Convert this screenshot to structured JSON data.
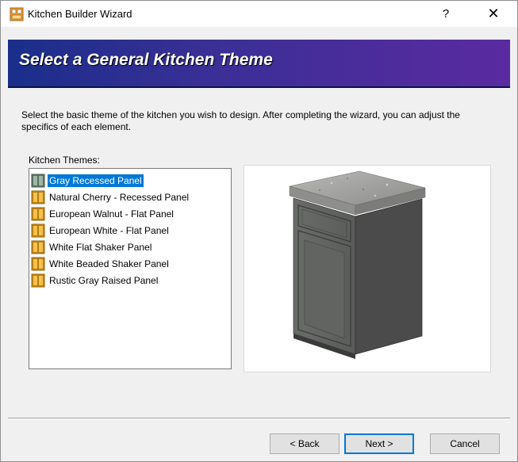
{
  "window": {
    "title": "Kitchen Builder Wizard",
    "help_label": "?",
    "close_label": "✕"
  },
  "banner": {
    "title": "Select a General Kitchen Theme"
  },
  "description": "Select the basic theme of the kitchen you wish to design. After completing the wizard, you can adjust the specifics of each element.",
  "themes": {
    "label": "Kitchen Themes:",
    "selected_index": 0,
    "items": [
      {
        "label": "Gray Recessed Panel",
        "icon": "cabinet-gray-icon"
      },
      {
        "label": "Natural Cherry - Recessed Panel",
        "icon": "cabinet-icon"
      },
      {
        "label": "European Walnut - Flat Panel",
        "icon": "cabinet-icon"
      },
      {
        "label": "European White - Flat Panel",
        "icon": "cabinet-icon"
      },
      {
        "label": "White Flat Shaker Panel",
        "icon": "cabinet-icon"
      },
      {
        "label": "White Beaded Shaker Panel",
        "icon": "cabinet-icon"
      },
      {
        "label": "Rustic Gray Raised Panel",
        "icon": "cabinet-icon"
      }
    ]
  },
  "buttons": {
    "back": "< Back",
    "next": "Next >",
    "cancel": "Cancel"
  },
  "colors": {
    "banner_start": "#1a2e8a",
    "banner_end": "#5a2aa0",
    "selection": "#0078d7",
    "cabinet_body": "#5c5e5c",
    "countertop": "#9a9a98"
  }
}
